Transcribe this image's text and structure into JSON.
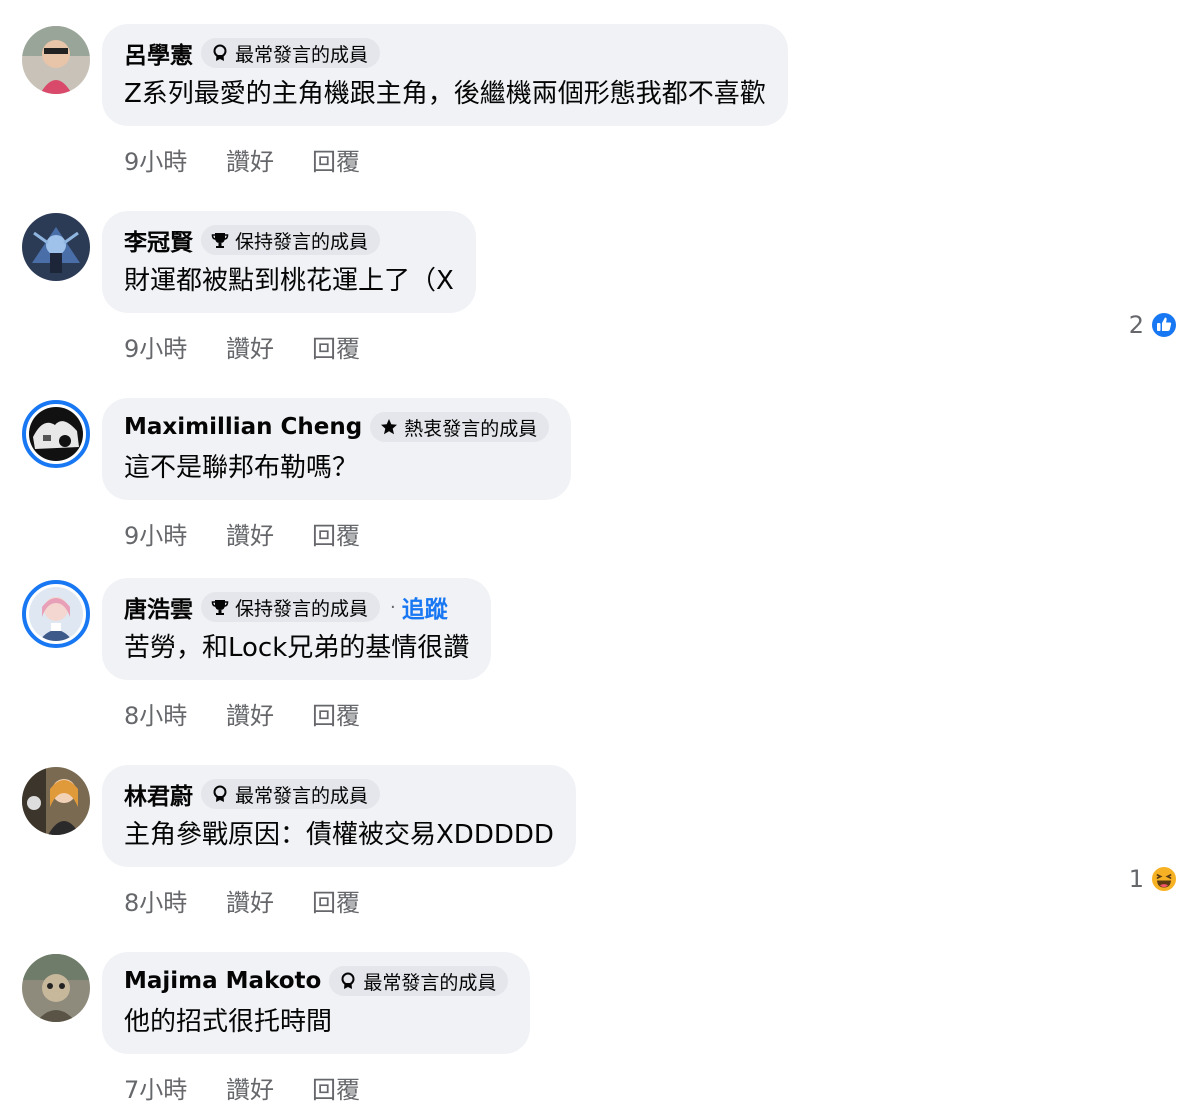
{
  "comments": [
    {
      "author": "呂學憲",
      "badge": {
        "icon": "rosette-icon",
        "label": "最常發言的成員"
      },
      "text": "Z系列最愛的主角機跟主角，後繼機兩個形態我都不喜歡",
      "time": "9小時",
      "like_label": "讚好",
      "reply_label": "回覆"
    },
    {
      "author": "李冠賢",
      "badge": {
        "icon": "trophy-icon",
        "label": "保持發言的成員"
      },
      "text": "財運都被點到桃花運上了（X",
      "time": "9小時",
      "like_label": "讚好",
      "reply_label": "回覆",
      "reaction": {
        "count": "2",
        "icon": "like-thumb-icon"
      }
    },
    {
      "author": "Maximillian Cheng",
      "badge": {
        "icon": "star-icon",
        "label": "熱衷發言的成員"
      },
      "text": "這不是聯邦布勒嗎？",
      "time": "9小時",
      "like_label": "讚好",
      "reply_label": "回覆"
    },
    {
      "author": "唐浩雲",
      "badge": {
        "icon": "trophy-icon",
        "label": "保持發言的成員"
      },
      "follow_separator": "·",
      "follow_label": "追蹤",
      "text": "苦勞，和Lock兄弟的基情很讚",
      "time": "8小時",
      "like_label": "讚好",
      "reply_label": "回覆"
    },
    {
      "author": "林君蔚",
      "badge": {
        "icon": "rosette-icon",
        "label": "最常發言的成員"
      },
      "text": "主角參戰原因：債權被交易XDDDDD",
      "time": "8小時",
      "like_label": "讚好",
      "reply_label": "回覆",
      "reaction": {
        "count": "1",
        "icon": "haha-emoji-icon"
      }
    },
    {
      "author": "Majima Makoto",
      "badge": {
        "icon": "rosette-icon",
        "label": "最常發言的成員"
      },
      "text": "他的招式很托時間",
      "time": "7小時",
      "like_label": "讚好",
      "reply_label": "回覆"
    }
  ],
  "colors": {
    "bubble_bg": "#f0f2f5",
    "badge_bg": "#e4e6eb",
    "meta_text": "#65676b",
    "accent_blue": "#1877f2",
    "haha_yellow": "#f7b125"
  }
}
